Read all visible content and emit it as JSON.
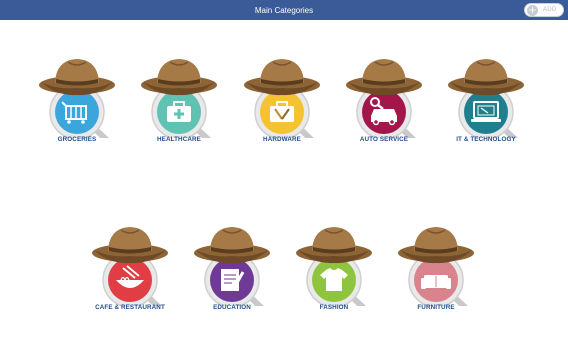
{
  "header": {
    "title": "Main Categories",
    "add_label": "ADD",
    "add_icon": "plus-icon",
    "background": "#3a5a98"
  },
  "categories": [
    {
      "label": "GROCERIES",
      "color": "#3aa6dc",
      "icon": "shopping-cart-icon"
    },
    {
      "label": "HEALTHCARE",
      "color": "#5fc2b2",
      "icon": "first-aid-kit-icon"
    },
    {
      "label": "HARDWARE",
      "color": "#f5c232",
      "icon": "toolbox-icon"
    },
    {
      "label": "AUTO SERVICE",
      "color": "#a3164a",
      "icon": "car-wrench-icon"
    },
    {
      "label": "IT & TECHNOLOGY",
      "color": "#1f7f8e",
      "icon": "laptop-icon"
    },
    {
      "label": "CAFE & RESTAURANT",
      "color": "#e03d44",
      "icon": "noodle-bowl-icon"
    },
    {
      "label": "EDUCATION",
      "color": "#6f3a95",
      "icon": "notebook-pencil-icon"
    },
    {
      "label": "FASHION",
      "color": "#8fc43f",
      "icon": "tshirt-icon"
    },
    {
      "label": "FURNITURE",
      "color": "#d9838c",
      "icon": "sofa-icon"
    }
  ]
}
